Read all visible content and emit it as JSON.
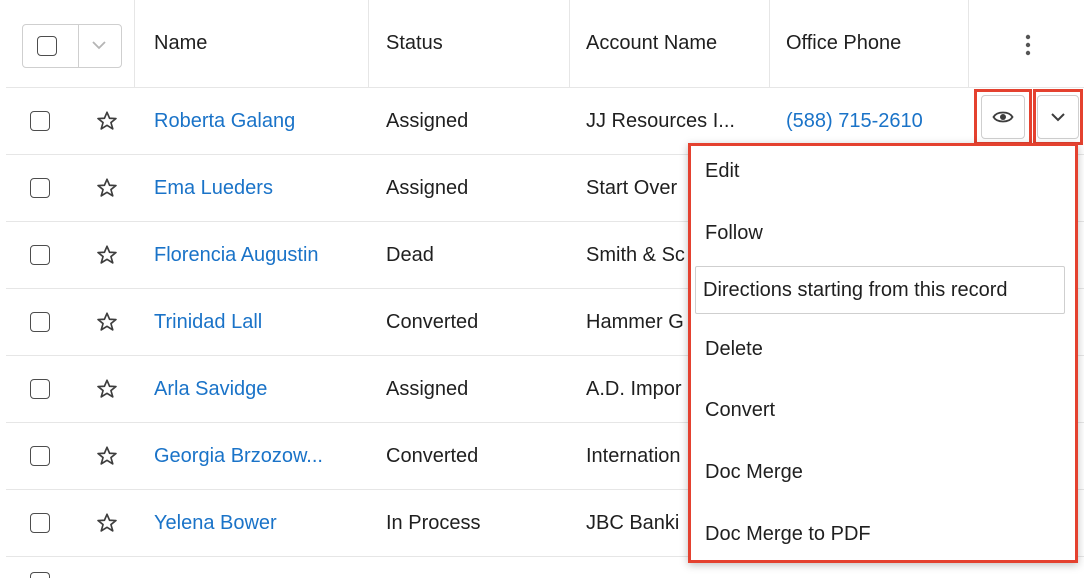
{
  "header": {
    "columns": [
      "Name",
      "Status",
      "Account Name",
      "Office Phone"
    ],
    "more_icon": "vertical-ellipsis-icon"
  },
  "rows": [
    {
      "name": "Roberta Galang",
      "status": "Assigned",
      "account": "JJ Resources I...",
      "phone": "(588) 715-2610"
    },
    {
      "name": "Ema Lueders",
      "status": "Assigned",
      "account": "Start Over",
      "phone": ""
    },
    {
      "name": "Florencia Augustin",
      "status": "Dead",
      "account": "Smith & Sc",
      "phone": ""
    },
    {
      "name": "Trinidad Lall",
      "status": "Converted",
      "account": "Hammer G",
      "phone": ""
    },
    {
      "name": "Arla Savidge",
      "status": "Assigned",
      "account": "A.D. Impor",
      "phone": ""
    },
    {
      "name": "Georgia Brzozow...",
      "status": "Converted",
      "account": "Internation",
      "phone": ""
    },
    {
      "name": "Yelena Bower",
      "status": "In Process",
      "account": "JBC Banki",
      "phone": ""
    }
  ],
  "menu": {
    "items": [
      "Edit",
      "Follow",
      "Directions starting from this record",
      "Delete",
      "Convert",
      "Doc Merge",
      "Doc Merge to PDF"
    ]
  },
  "colors": {
    "link": "#1a73c8",
    "highlight": "#e4412f"
  }
}
